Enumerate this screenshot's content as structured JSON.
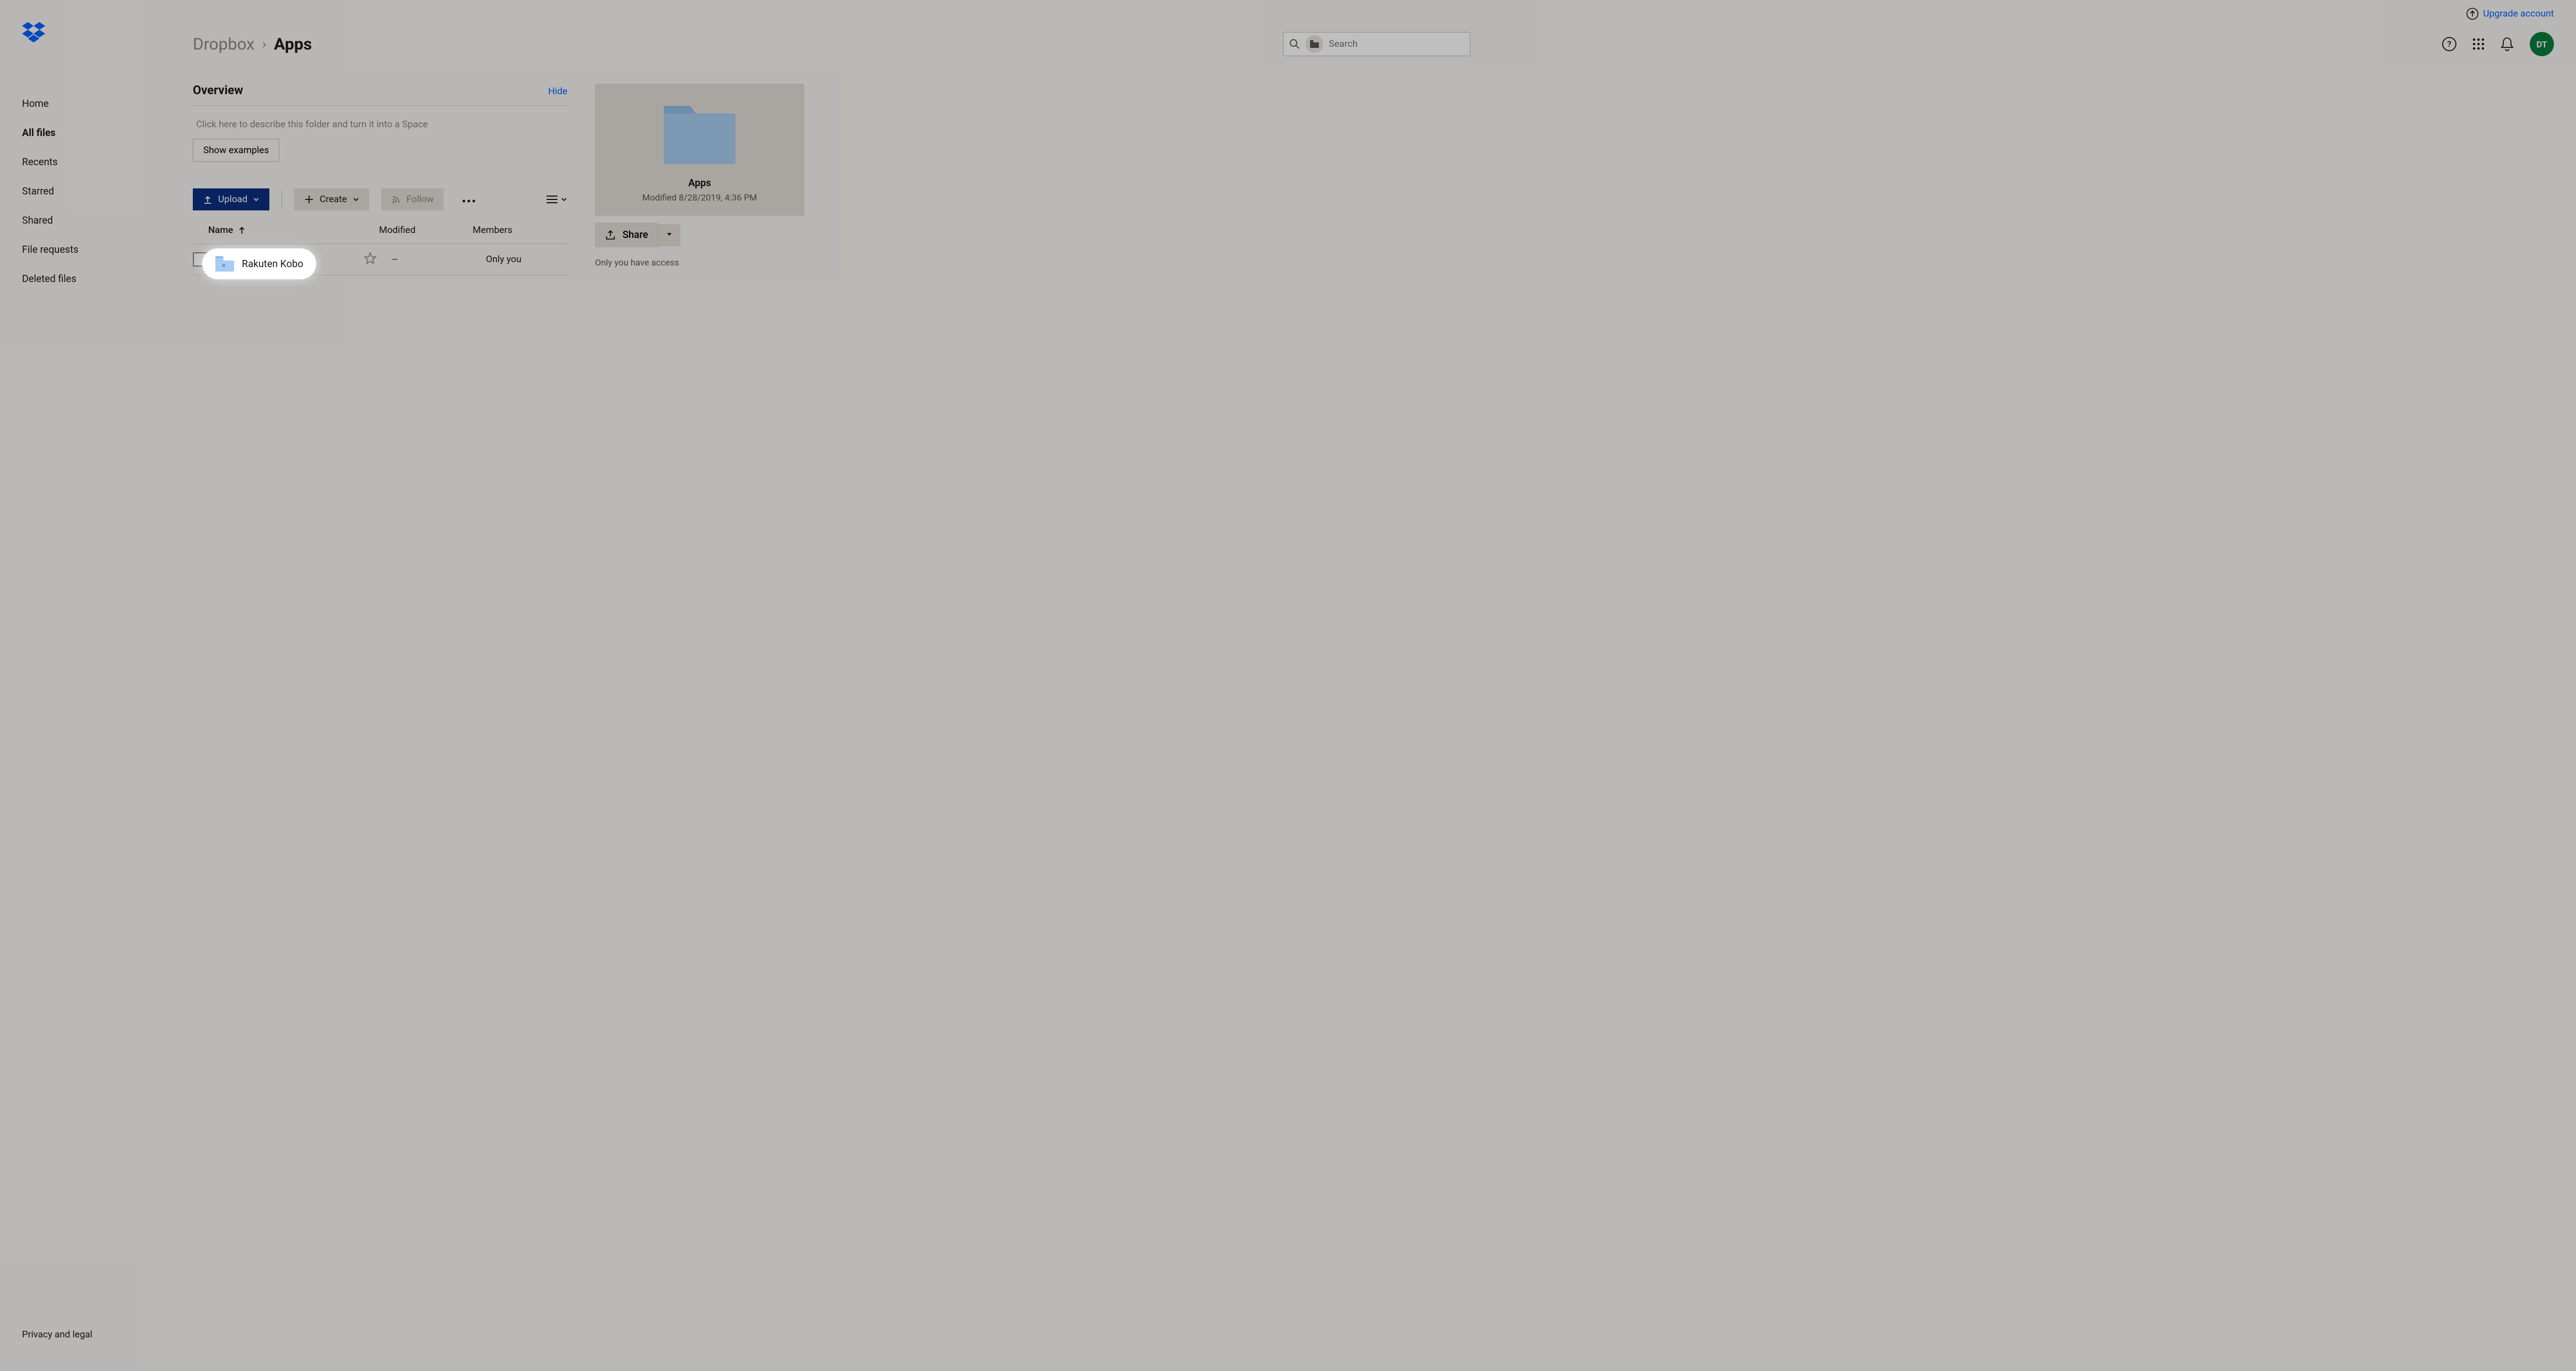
{
  "topbar": {
    "upgrade": "Upgrade account"
  },
  "sidebar": {
    "items": [
      {
        "label": "Home"
      },
      {
        "label": "All files"
      },
      {
        "label": "Recents"
      },
      {
        "label": "Starred"
      },
      {
        "label": "Shared"
      },
      {
        "label": "File requests"
      },
      {
        "label": "Deleted files"
      }
    ],
    "footer": "Privacy and legal"
  },
  "breadcrumb": {
    "root": "Dropbox",
    "current": "Apps"
  },
  "search": {
    "placeholder": "Search"
  },
  "avatar": "DT",
  "overview": {
    "title": "Overview",
    "hide": "Hide",
    "placeholder": "Click here to describe this folder and turn it into a Space",
    "show_examples": "Show examples"
  },
  "toolbar": {
    "upload": "Upload",
    "create": "Create",
    "follow": "Follow"
  },
  "table": {
    "columns": {
      "name": "Name",
      "modified": "Modified",
      "members": "Members"
    },
    "rows": [
      {
        "name": "Rakuten Kobo",
        "modified": "--",
        "members": "Only you"
      }
    ]
  },
  "detail": {
    "name": "Apps",
    "modified": "Modified 8/28/2019, 4:36 PM",
    "share": "Share",
    "access": "Only you have access"
  },
  "highlight": {
    "name": "Rakuten Kobo"
  }
}
